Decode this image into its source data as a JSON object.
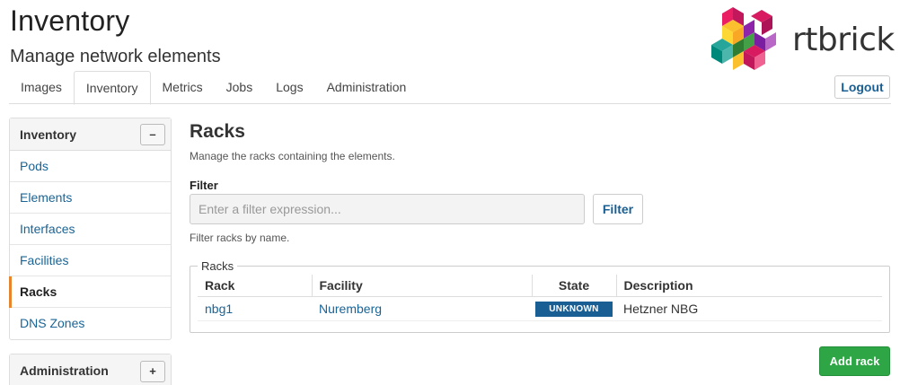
{
  "header": {
    "title": "Inventory",
    "subtitle": "Manage network elements",
    "logo_text": "rtbrick"
  },
  "tabs": [
    {
      "label": "Images",
      "active": false
    },
    {
      "label": "Inventory",
      "active": true
    },
    {
      "label": "Metrics",
      "active": false
    },
    {
      "label": "Jobs",
      "active": false
    },
    {
      "label": "Logs",
      "active": false
    },
    {
      "label": "Administration",
      "active": false
    }
  ],
  "logout_label": "Logout",
  "sidebar": {
    "inventory_panel": {
      "title": "Inventory",
      "toggle": "–",
      "items": [
        {
          "label": "Pods"
        },
        {
          "label": "Elements"
        },
        {
          "label": "Interfaces"
        },
        {
          "label": "Facilities"
        },
        {
          "label": "Racks"
        },
        {
          "label": "DNS Zones"
        }
      ],
      "active_item": "Racks"
    },
    "admin_panel": {
      "title": "Administration",
      "toggle": "+"
    }
  },
  "main": {
    "title": "Racks",
    "description": "Manage the racks containing the elements.",
    "filter": {
      "label": "Filter",
      "placeholder": "Enter a filter expression...",
      "button": "Filter",
      "help": "Filter racks by name."
    },
    "racks": {
      "legend": "Racks",
      "columns": [
        "Rack",
        "Facility",
        "State",
        "Description"
      ],
      "rows": [
        {
          "rack": "nbg1",
          "facility": "Nuremberg",
          "state": "UNKNOWN",
          "description": "Hetzner NBG"
        }
      ]
    },
    "add_button": "Add rack"
  },
  "colors": {
    "link": "#1a6496",
    "state_unknown": "#1a5f93",
    "add_button": "#2ea645",
    "active_marker": "#e8842c"
  }
}
